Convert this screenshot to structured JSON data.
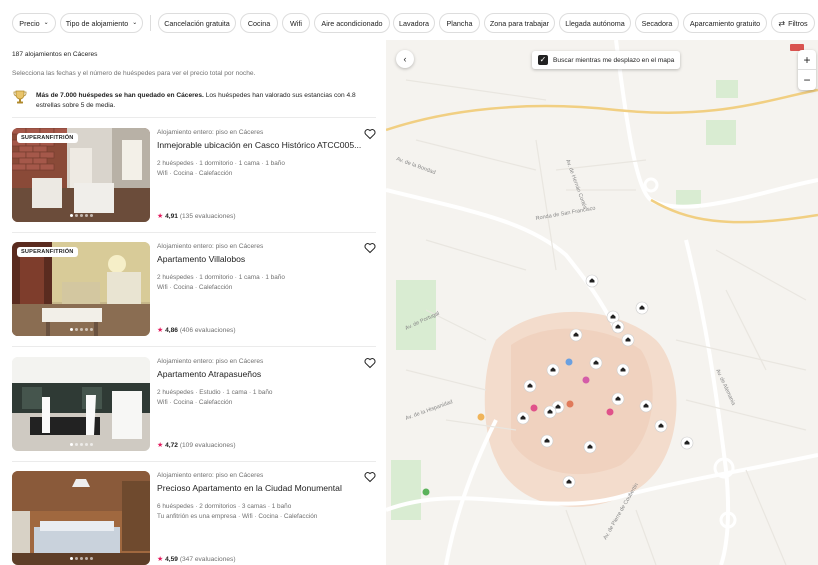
{
  "filters": {
    "price": "Precio",
    "type": "Tipo de alojamiento",
    "chips": [
      "Cancelación gratuita",
      "Cocina",
      "Wifi",
      "Aire acondicionado",
      "Lavadora",
      "Plancha",
      "Zona para trabajar",
      "Llegada autónoma",
      "Secadora",
      "Aparcamiento gratuito"
    ],
    "more": "Filtros"
  },
  "results": {
    "count": "187 alojamientos en Cáceres",
    "hint": "Selecciona las fechas y el número de huéspedes para ver el precio total por noche.",
    "promo_bold": "Más de 7.000 huéspedes se han quedado en Cáceres.",
    "promo_rest": " Los huéspedes han valorado sus estancias con 4.8 estrellas sobre 5 de media."
  },
  "listings": [
    {
      "badge": "SUPERANFITRIÓN",
      "type": "Alojamiento entero: piso en Cáceres",
      "title": "Inmejorable ubicación en Casco Histórico ATCC005...",
      "details": "2 huéspedes · 1 dormitorio · 1 cama · 1 baño",
      "amenities": "Wifi · Cocina · Calefacción",
      "rating": "4,91",
      "reviews": "(135 evaluaciones)"
    },
    {
      "badge": "SUPERANFITRIÓN",
      "type": "Alojamiento entero: piso en Cáceres",
      "title": "Apartamento Villalobos",
      "details": "2 huéspedes · 1 dormitorio · 1 cama · 1 baño",
      "amenities": "Wifi · Cocina · Calefacción",
      "rating": "4,86",
      "reviews": "(406 evaluaciones)"
    },
    {
      "badge": "",
      "type": "Alojamiento entero: piso en Cáceres",
      "title": "Apartamento Atrapasueños",
      "details": "2 huéspedes · Estudio · 1 cama · 1 baño",
      "amenities": "Wifi · Cocina · Calefacción",
      "rating": "4,72",
      "reviews": "(109 evaluaciones)"
    },
    {
      "badge": "",
      "type": "Alojamiento entero: piso en Cáceres",
      "title": "Precioso Apartamento en la Ciudad Monumental",
      "details": "6 huéspedes · 2 dormitorios · 3 camas · 1 baño",
      "amenities": "Tu anfitrión es una empresa · Wifi · Cocina · Calefacción",
      "rating": "4,59",
      "reviews": "(347 evaluaciones)"
    }
  ],
  "map": {
    "search_toggle": "Buscar mientras me desplazo en el mapa",
    "zoom_in": "+",
    "zoom_out": "−",
    "street_labels": [
      "Av. de Hernán Cortés",
      "Av. de la Hispanidad",
      "Av. de Pierre de Coubertin",
      "Ronda de San Francisco",
      "Av. de Portugal",
      "Av. de Alemania",
      "Av. de la Bondad"
    ]
  }
}
